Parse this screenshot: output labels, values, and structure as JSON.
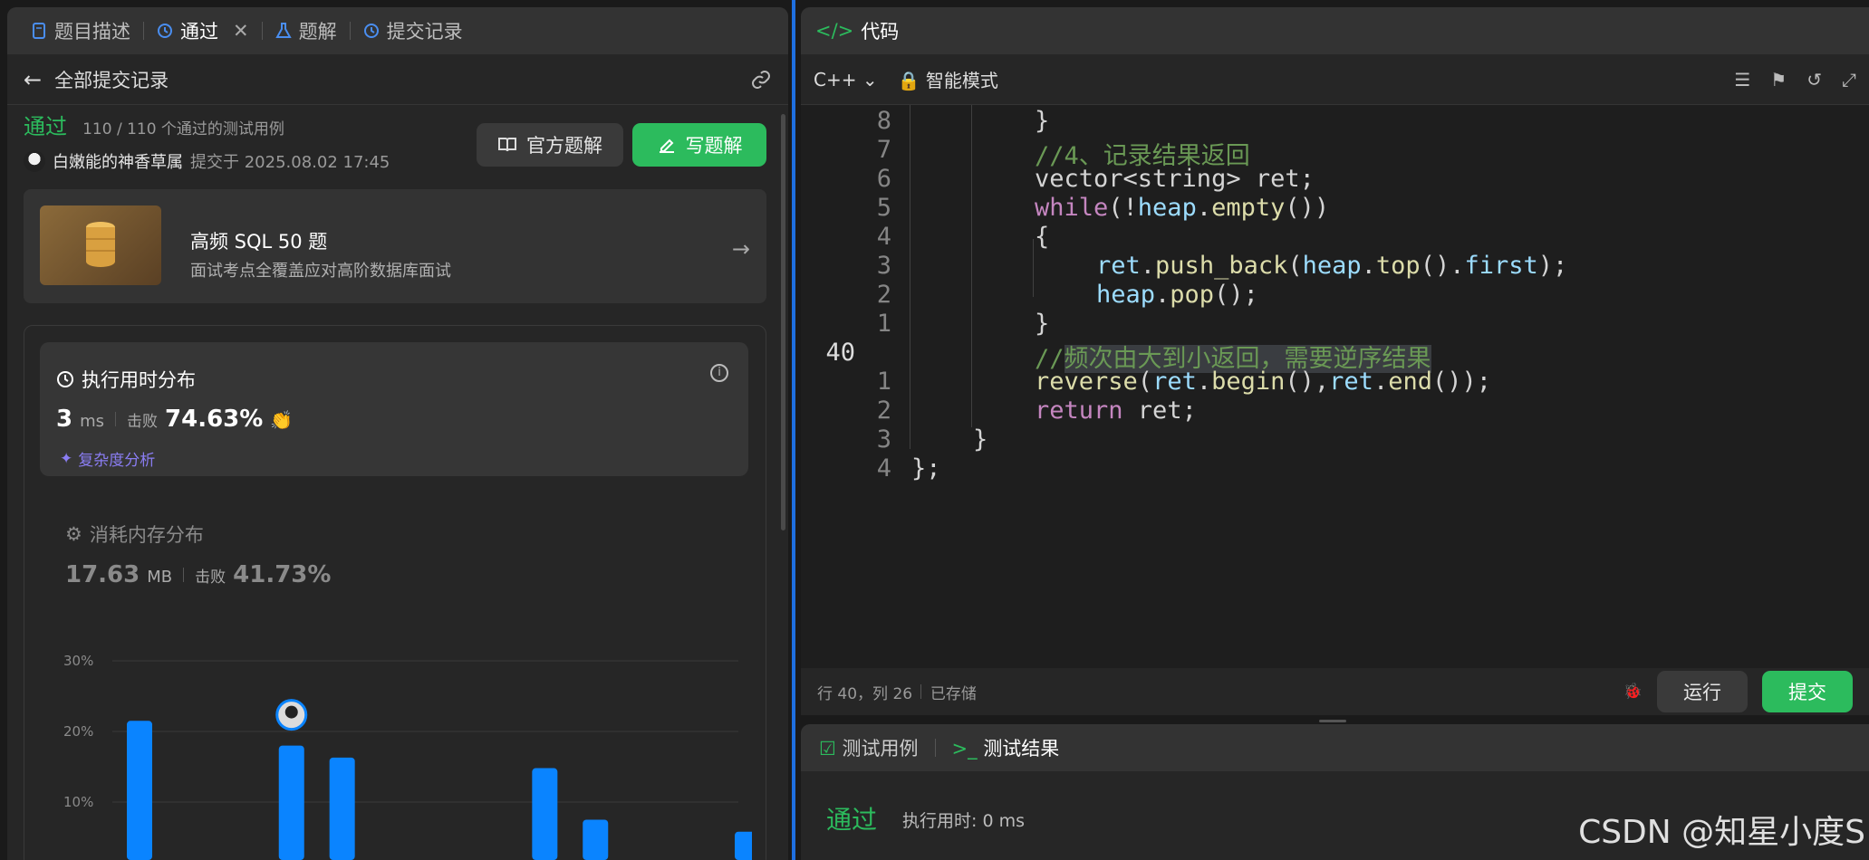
{
  "left_tabs": [
    {
      "label": "题目描述"
    },
    {
      "label": "通过"
    },
    {
      "label": "题解"
    },
    {
      "label": "提交记录"
    }
  ],
  "back_label": "全部提交记录",
  "result": {
    "status": "通过",
    "cases": "110 / 110 个通过的测试用例",
    "user": "白嫩能的神香草属",
    "submitted": "提交于 2025.08.02 17:45"
  },
  "buttons": {
    "official": "官方题解",
    "write": "写题解"
  },
  "promo": {
    "title": "高频 SQL 50 题",
    "subtitle": "面试考点全覆盖应对高阶数据库面试"
  },
  "runtime": {
    "title": "执行用时分布",
    "value": "3",
    "unit": "ms",
    "beat_label": "击败",
    "beat": "74.63%",
    "complexity": "复杂度分析"
  },
  "memory": {
    "title": "消耗内存分布",
    "value": "17.63",
    "unit": "MB",
    "beat_label": "击败",
    "beat": "41.73%"
  },
  "chart_data": {
    "type": "bar",
    "ytick_labels": [
      "30%",
      "20%",
      "10%"
    ],
    "ylim": [
      0,
      30
    ],
    "values": [
      21.5,
      0,
      0,
      18,
      16.3,
      0,
      0,
      0.2,
      14.8,
      7.5,
      0,
      0,
      5.8
    ],
    "highlight_index": 3,
    "color": "#0a84ff"
  },
  "right": {
    "title": "代码",
    "lang": "C++",
    "mode": "智能模式",
    "status_pos": "行 40，列 26",
    "status_saved": "已存储",
    "run": "运行",
    "submit": "提交"
  },
  "line_numbers": [
    "8",
    "7",
    "6",
    "5",
    "4",
    "3",
    "2",
    "1",
    "40",
    "1",
    "2",
    "3",
    "4"
  ],
  "bottom": {
    "tab1": "测试用例",
    "tab2": "测试结果",
    "status": "通过",
    "time": "执行用时: 0 ms"
  },
  "watermark": "CSDN @知星小度S",
  "colors": {
    "accent_green": "#2cbb5d",
    "bar_blue": "#0a84ff",
    "divider_blue": "#1f6fe0"
  }
}
